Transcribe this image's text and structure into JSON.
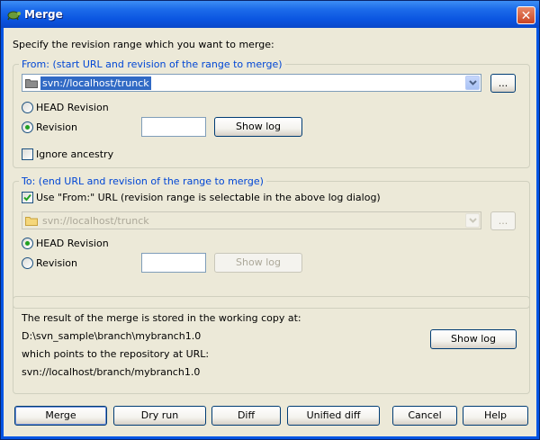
{
  "window": {
    "title": "Merge",
    "close_label": "✕"
  },
  "instruction": "Specify the revision range which you want to merge:",
  "from_group": {
    "legend": "From: (start URL and revision of the range to merge)",
    "url": "svn://localhost/trunck",
    "browse_label": "...",
    "head_revision_label": "HEAD Revision",
    "revision_label": "Revision",
    "revision_value": "",
    "show_log_label": "Show log",
    "ignore_ancestry_label": "Ignore ancestry",
    "selected": "revision",
    "ignore_ancestry_checked": false
  },
  "to_group": {
    "legend": "To: (end URL and revision of the range to merge)",
    "use_from_label": "Use \"From:\" URL (revision range is selectable in the above log dialog)",
    "use_from_checked": true,
    "url": "svn://localhost/trunck",
    "browse_label": "...",
    "head_revision_label": "HEAD Revision",
    "revision_label": "Revision",
    "revision_value": "",
    "show_log_label": "Show log",
    "selected": "head"
  },
  "result": {
    "line1": "The result of the merge is stored in the working copy at:",
    "working_copy": "D:\\svn_sample\\branch\\mybranch1.0",
    "line3": "which points to the repository at URL:",
    "repo_url": "svn://localhost/branch/mybranch1.0",
    "show_log_label": "Show log"
  },
  "buttons": {
    "merge": "Merge",
    "dry_run": "Dry run",
    "diff": "Diff",
    "unified_diff": "Unified diff",
    "cancel": "Cancel",
    "help": "Help"
  },
  "icons": {
    "app": "tortoisesvn-icon",
    "folder": "folder-icon",
    "dropdown": "chevron-down-icon",
    "close": "close-icon"
  },
  "colors": {
    "titlebar": "#0a54e0",
    "dialog_bg": "#ece9d8",
    "legend_text": "#0046d5",
    "selection": "#316ac5"
  }
}
